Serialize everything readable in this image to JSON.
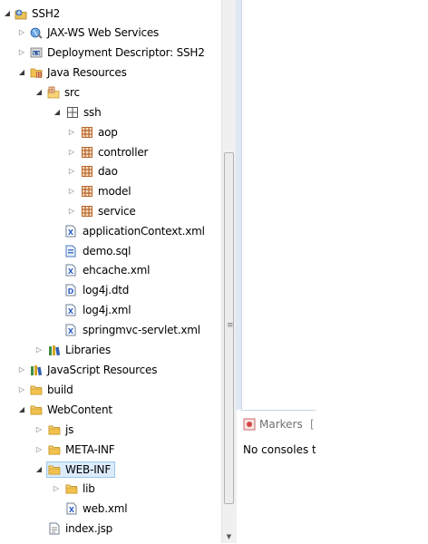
{
  "tree": {
    "project": "SSH2",
    "jaxws": "JAX-WS Web Services",
    "deployment_descriptor": "Deployment Descriptor: SSH2",
    "java_resources": "Java Resources",
    "src": "src",
    "ssh": "ssh",
    "aop": "aop",
    "controller": "controller",
    "dao": "dao",
    "model": "model",
    "service": "service",
    "application_context": "applicationContext.xml",
    "demo_sql": "demo.sql",
    "ehcache": "ehcache.xml",
    "log4j_dtd": "log4j.dtd",
    "log4j_xml": "log4j.xml",
    "springmvc_servlet": "springmvc-servlet.xml",
    "libraries": "Libraries",
    "javascript_resources": "JavaScript Resources",
    "build": "build",
    "webcontent": "WebContent",
    "js": "js",
    "meta_inf": "META-INF",
    "web_inf": "WEB-INF",
    "lib": "lib",
    "web_xml": "web.xml",
    "index_jsp": "index.jsp"
  },
  "console": {
    "markers_tab": "Markers",
    "tab_separator": "[",
    "empty_message": "No consoles t"
  },
  "icons": {
    "project": "project-icon",
    "webservices": "webservices-icon",
    "deployment": "deployment-descriptor-icon",
    "java_resources": "java-resources-icon",
    "source_folder": "source-folder-icon",
    "package": "package-icon",
    "xml_file": "xml-file-icon",
    "sql_file": "sql-file-icon",
    "dtd_file": "dtd-file-icon",
    "library": "library-icon",
    "folder": "folder-icon",
    "jsp_file": "jsp-file-icon",
    "markers": "markers-icon"
  },
  "colors": {
    "selection_bg": "#dcebfc",
    "selection_border": "#9ac7e9",
    "folder": "#f2c14e",
    "package": "#b9652b",
    "xml": "#3b6bd6",
    "right_panel": "#dfe8f4"
  }
}
